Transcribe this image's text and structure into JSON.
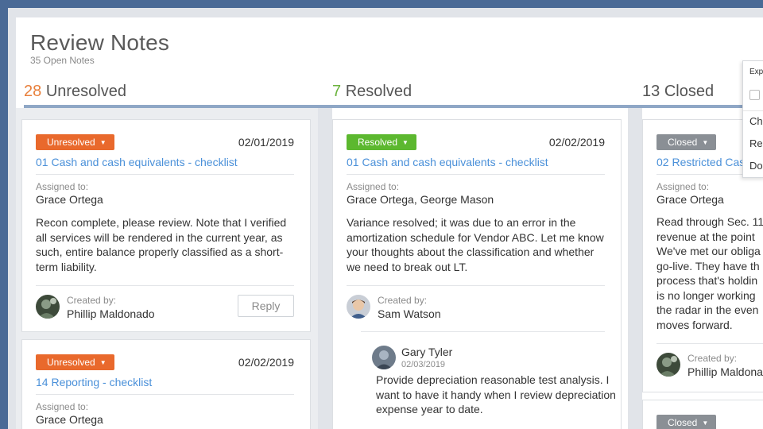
{
  "header": {
    "title": "Review Notes",
    "subtitle": "35 Open Notes"
  },
  "columns": [
    {
      "count": "28",
      "label": "Unresolved"
    },
    {
      "count": "7",
      "label": "Resolved"
    },
    {
      "count": "13",
      "label": "Closed"
    }
  ],
  "labels": {
    "assigned_to": "Assigned to:",
    "created_by": "Created by:",
    "reply": "Reply"
  },
  "unresolved_cards": [
    {
      "status": "Unresolved",
      "date": "02/01/2019",
      "link": "01 Cash and cash equivalents - checklist",
      "assignee": "Grace Ortega",
      "body": "Recon complete, please review. Note that I verified all services will be rendered in the current year, as such, entire balance properly classified as a short-term liability.",
      "creator": "Phillip Maldonado"
    },
    {
      "status": "Unresolved",
      "date": "02/02/2019",
      "link": "14 Reporting - checklist",
      "assignee": "Grace Ortega"
    }
  ],
  "resolved_cards": [
    {
      "status": "Resolved",
      "date": "02/02/2019",
      "link": "01 Cash and cash equivalents - checklist",
      "assignee": "Grace Ortega, George Mason",
      "body": "Variance resolved; it was due to an error in the amortization schedule for Vendor ABC. Let me know your thoughts about the classification and whether we need to break out LT.",
      "creator": "Sam Watson",
      "reply": {
        "author": "Gary Tyler",
        "date": "02/03/2019",
        "body": "Provide depreciation reasonable test analysis. I want to have it handy when I review depreciation expense year to date."
      }
    }
  ],
  "closed_cards": [
    {
      "status": "Closed",
      "link": "02 Restricted Cas",
      "assignee": "Grace Ortega",
      "body_lines": [
        "Read through Sec. 11",
        "revenue at the point",
        "We've met our obliga",
        "go-live. They have th",
        "process that's holdin",
        "is no longer working",
        "the radar in the even",
        "moves forward."
      ],
      "creator": "Phillip Maldona"
    },
    {
      "status": "Closed"
    }
  ],
  "dropdown": {
    "item0": "Exp",
    "item1": "Ch",
    "item2": "Re",
    "item3": "Do"
  },
  "colors": {
    "unresolved": "#e9692c",
    "resolved": "#5cb82f",
    "closed": "#8a8f95",
    "link": "#4a90d9",
    "accent_bar": "#8fa7c6"
  }
}
